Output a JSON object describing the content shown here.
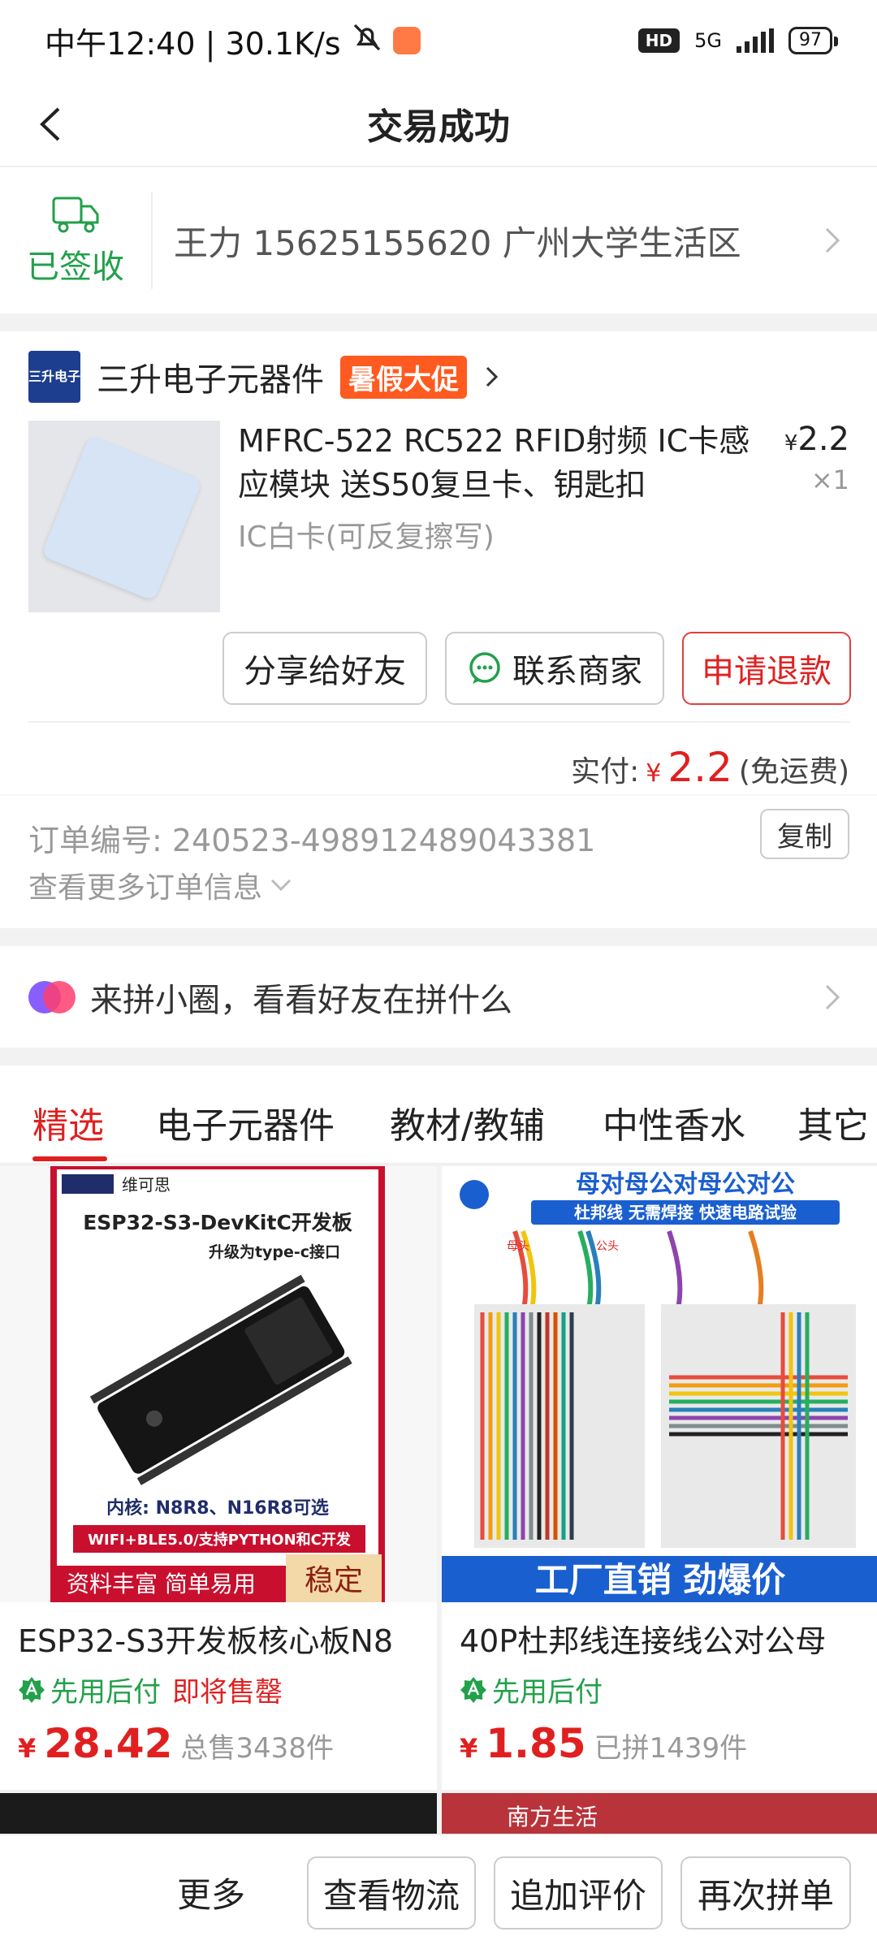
{
  "status_bar": {
    "time_label": "中午12:40 | 30.1K/s",
    "hd": "HD",
    "network": "5G",
    "battery": "97"
  },
  "nav": {
    "title": "交易成功"
  },
  "delivery": {
    "status": "已签收",
    "address": "王力 15625155620 广州大学生活区"
  },
  "shop": {
    "logo_text": "三升电子",
    "name": "三升电子元器件",
    "promo": "暑假大促"
  },
  "product": {
    "title": "MFRC-522 RC522 RFID射频 IC卡感应模块 送S50复旦卡、钥匙扣",
    "spec": "IC白卡(可反复擦写)",
    "currency": "¥",
    "price": "2.2",
    "quantity": "×1"
  },
  "actions": {
    "share": "分享给好友",
    "contact": "联系商家",
    "refund": "申请退款"
  },
  "payment": {
    "label": "实付:",
    "currency": "¥",
    "amount": "2.2",
    "note": "(免运费)"
  },
  "order": {
    "number_label": "订单编号: 240523-498912489043381",
    "copy": "复制",
    "more_info": "查看更多订单信息"
  },
  "circle": {
    "text": "来拼小圈，看看好友在拼什么"
  },
  "tabs": [
    {
      "label": "精选"
    },
    {
      "label": "电子元器件"
    },
    {
      "label": "教材/教辅"
    },
    {
      "label": "中性香水"
    },
    {
      "label": "其它"
    }
  ],
  "recommendations": [
    {
      "image_texts": [
        "维可思",
        "ESP32-S3-DevKitC开发板",
        "升级为type-c接口",
        "内核: N8R8、N16R8可选",
        "WIFI+BLE5.0/支持PYTHON和C开发",
        "资料丰富 简单易用",
        "稳定"
      ],
      "title": "ESP32-S3开发板核心板N8",
      "tag_green": "先用后付",
      "tag_red": "即将售罄",
      "currency": "¥",
      "price": "28.42",
      "sales": "总售3438件"
    },
    {
      "image_texts": [
        "母对母公对母公对公",
        "杜邦线 无需焊接 快速电路试验",
        "母头",
        "公头",
        "工厂直销 劲爆价"
      ],
      "title": "40P杜邦线连接线公对公母",
      "tag_green": "先用后付",
      "tag_red": "",
      "currency": "¥",
      "price": "1.85",
      "sales": "已拼1439件"
    }
  ],
  "next_card_text": "南方生活",
  "bottom_bar": {
    "more": "更多",
    "logistics": "查看物流",
    "review": "追加评价",
    "reorder": "再次拼单"
  },
  "colors": {
    "accent_red": "#e02020",
    "green": "#22a04b",
    "promo_orange": "#ff5a1f"
  }
}
